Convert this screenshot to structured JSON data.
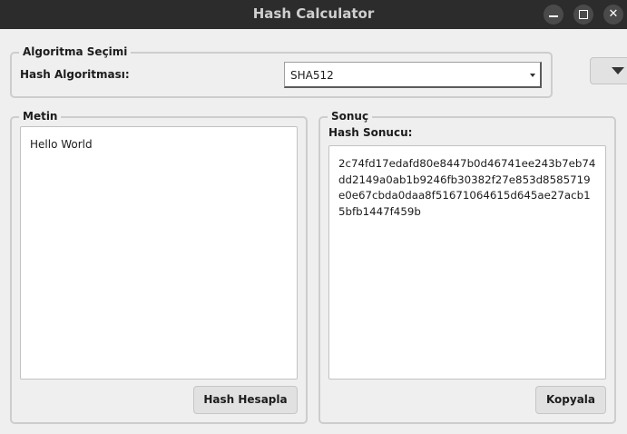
{
  "window": {
    "title": "Hash Calculator"
  },
  "algorithm_group": {
    "title": "Algoritma Seçimi",
    "label": "Hash Algoritması:",
    "selected": "SHA512"
  },
  "input_group": {
    "title": "Metin",
    "text": "Hello World",
    "button_label": "Hash Hesapla"
  },
  "result_group": {
    "title": "Sonuç",
    "label": "Hash Sonucu:",
    "hash": "2c74fd17edafd80e8447b0d46741ee243b7eb74dd2149a0ab1b9246fb30382f27e853d8585719e0e67cbda0daa8f51671064615d645ae27acb15bfb1447f459b",
    "button_label": "Kopyala"
  }
}
